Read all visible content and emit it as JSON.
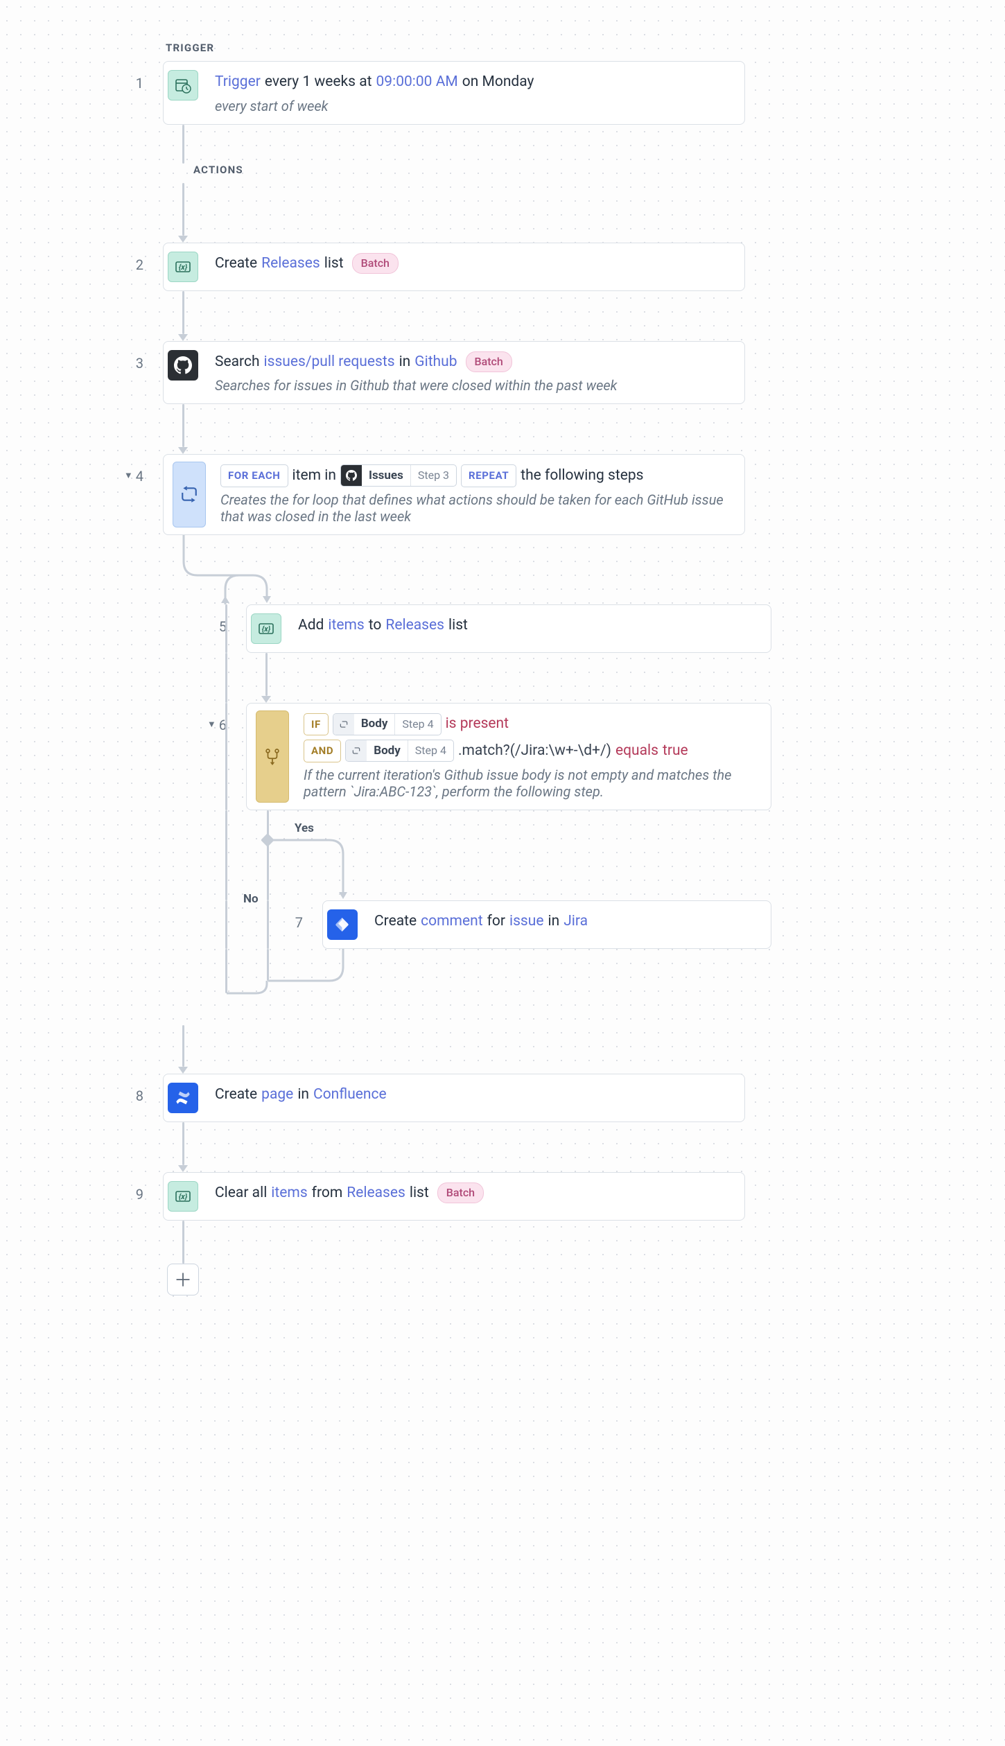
{
  "sections": {
    "trigger_label": "TRIGGER",
    "actions_label": "ACTIONS"
  },
  "step1": {
    "num": "1",
    "l1_link": "Trigger",
    "l1_a": " every 1 weeks at ",
    "l1_time": "09:00:00 AM",
    "l1_b": " on Monday",
    "desc": "every start of week"
  },
  "step2": {
    "num": "2",
    "a": "Create ",
    "link": "Releases",
    "b": " list",
    "batch": "Batch"
  },
  "step3": {
    "num": "3",
    "a": "Search ",
    "link1": "issues/pull requests",
    "b": " in ",
    "link2": "Github",
    "batch": "Batch",
    "desc": "Searches for issues in Github that were closed within the past week"
  },
  "step4": {
    "num": "4",
    "foreach": "FOR EACH",
    "itemin": " item in ",
    "pill_label": "Issues",
    "pill_step": "Step 3",
    "repeat": "REPEAT",
    "tail": " the following steps",
    "desc": "Creates the for loop that defines what actions should be taken for each GitHub issue that was closed in the last week"
  },
  "step5": {
    "num": "5",
    "a": "Add ",
    "link1": "items",
    "b": " to ",
    "link2": "Releases",
    "c": " list"
  },
  "step6": {
    "num": "6",
    "if": "IF",
    "pill1_label": "Body",
    "pill1_step": "Step 4",
    "cond1": "is present",
    "and": "AND",
    "pill2_label": "Body",
    "pill2_step": "Step 4",
    "fn": ".match?(/Jira:\\w+-\\d+/)",
    "eq": " equals ",
    "true": "true",
    "desc": "If the current iteration's Github issue body is  not empty and matches the pattern `Jira:ABC-123`, perform the following step."
  },
  "branch": {
    "yes": "Yes",
    "no": "No"
  },
  "step7": {
    "num": "7",
    "a": "Create ",
    "link1": "comment",
    "b": " for ",
    "link2": "issue",
    "c": " in ",
    "link3": "Jira"
  },
  "step8": {
    "num": "8",
    "a": "Create ",
    "link1": "page",
    "b": " in ",
    "link2": "Confluence"
  },
  "step9": {
    "num": "9",
    "a": "Clear all ",
    "link1": "items",
    "b": " from ",
    "link2": "Releases",
    "c": " list",
    "batch": "Batch"
  }
}
